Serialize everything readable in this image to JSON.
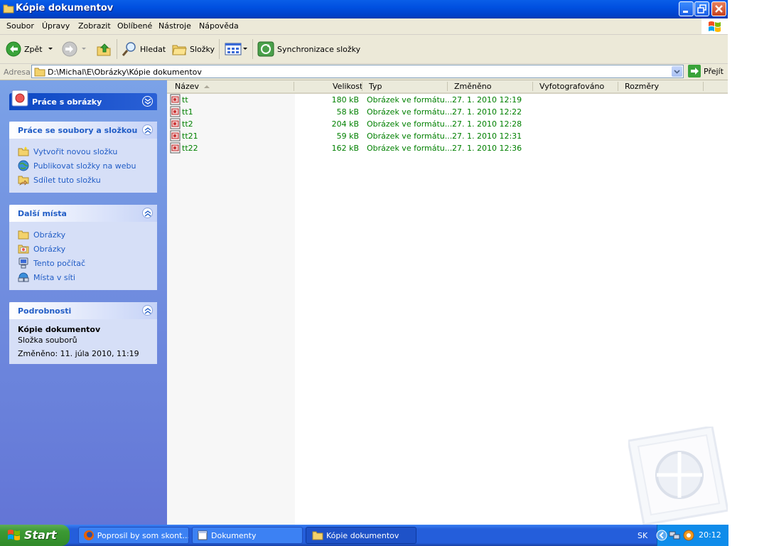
{
  "window": {
    "title": "Kópie dokumentov"
  },
  "menu": [
    "Soubor",
    "Úpravy",
    "Zobrazit",
    "Oblíbené",
    "Nástroje",
    "Nápověda"
  ],
  "toolbar": {
    "back": "Zpět",
    "search": "Hledat",
    "folders": "Složky",
    "sync": "Synchronizace složky"
  },
  "address": {
    "label": "Adresa",
    "path": "D:\\Michal\\E\\Obrázky\\Kópie dokumentov",
    "go": "Přejít"
  },
  "tasks": {
    "picture_tasks": "Práce s obrázky",
    "file_tasks": {
      "title": "Práce se soubory a složkou",
      "items": [
        "Vytvořit novou složku",
        "Publikovat složky na webu",
        "Sdílet tuto složku"
      ]
    },
    "other_places": {
      "title": "Další místa",
      "items": [
        "Obrázky",
        "Obrázky",
        "Tento počítač",
        "Místa v síti"
      ]
    },
    "details": {
      "title": "Podrobnosti",
      "name": "Kópie dokumentov",
      "type": "Složka souborů",
      "modified": "Změněno: 11. júla 2010, 11:19"
    }
  },
  "columns": [
    "Název",
    "Velikost",
    "Typ",
    "Změněno",
    "Vyfotografováno",
    "Rozměry"
  ],
  "files": [
    {
      "name": "tt",
      "size": "180 kB",
      "type": "Obrázek ve formátu...",
      "modified": "27. 1. 2010 12:19"
    },
    {
      "name": "tt1",
      "size": "58 kB",
      "type": "Obrázek ve formátu...",
      "modified": "27. 1. 2010 12:22"
    },
    {
      "name": "tt2",
      "size": "204 kB",
      "type": "Obrázek ve formátu...",
      "modified": "27. 1. 2010 12:28"
    },
    {
      "name": "tt21",
      "size": "59 kB",
      "type": "Obrázek ve formátu...",
      "modified": "27. 1. 2010 12:31"
    },
    {
      "name": "tt22",
      "size": "162 kB",
      "type": "Obrázek ve formátu...",
      "modified": "27. 1. 2010 12:36"
    }
  ],
  "taskbar": {
    "start": "Start",
    "buttons": [
      "Poprosil by som skont...",
      "Dokumenty",
      "Kópie dokumentov"
    ],
    "language": "SK",
    "clock": "20:12"
  },
  "colors": {
    "title_blue": "#0050e0",
    "link_blue": "#215dc6",
    "file_green": "#008000",
    "start_green": "#3c9a34"
  }
}
